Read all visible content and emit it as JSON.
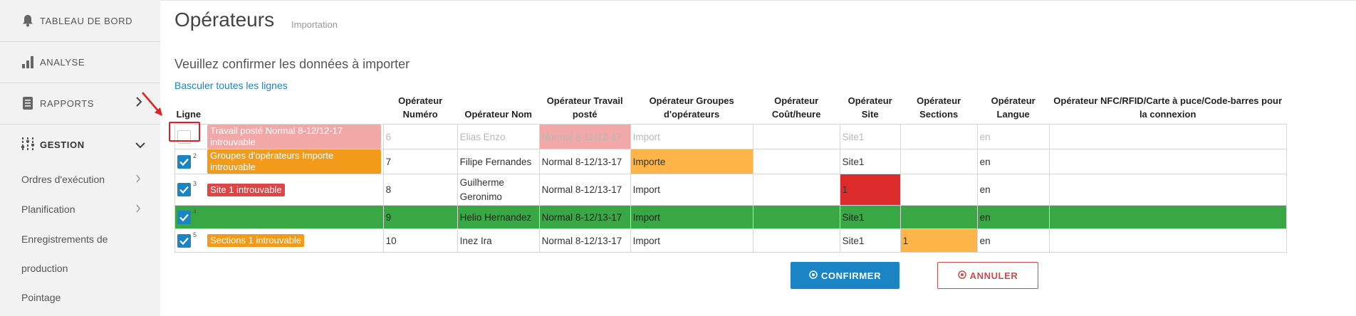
{
  "sidebar": {
    "items": [
      {
        "label": "TABLEAU DE BORD",
        "icon": "bell-icon"
      },
      {
        "label": "ANALYSE",
        "icon": "bar-chart-icon"
      },
      {
        "label": "RAPPORTS",
        "icon": "document-icon"
      },
      {
        "label": "GESTION",
        "icon": "sliders-icon"
      }
    ],
    "sub_items": [
      {
        "label": "Ordres d'exécution"
      },
      {
        "label": "Planification"
      },
      {
        "label": "Enregistrements de"
      },
      {
        "label": "production"
      },
      {
        "label": "Pointage"
      }
    ]
  },
  "page": {
    "title": "Opérateurs",
    "subtitle": "Importation",
    "confirm_text": "Veuillez confirmer les données à importer",
    "toggle_link": "Basculer toutes les lignes"
  },
  "table": {
    "headers": [
      "Ligne",
      "Opérateur Numéro",
      "Opérateur Nom",
      "Opérateur Travail posté",
      "Opérateur Groupes d'opérateurs",
      "Opérateur Coût/heure",
      "Opérateur Site",
      "Opérateur Sections",
      "Opérateur Langue",
      "Opérateur NFC/RFID/Carte à puce/Code-barres pour la connexion"
    ],
    "rows": [
      {
        "num": "",
        "checked": false,
        "error": "Travail posté Normal 8-12/12-17 introuvable",
        "numero": "6",
        "nom": "Elias Enzo",
        "travail": "Normal 8-12/12-17",
        "groupes": "Import",
        "cout": "",
        "site": "Site1",
        "sections": "",
        "langue": "en",
        "nfc": ""
      },
      {
        "num": "2",
        "checked": true,
        "error": "Groupes d'opérateurs Importe introuvable",
        "numero": "7",
        "nom": "Filipe Fernandes",
        "travail": "Normal 8-12/13-17",
        "groupes": "Importe",
        "cout": "",
        "site": "Site1",
        "sections": "",
        "langue": "en",
        "nfc": ""
      },
      {
        "num": "3",
        "checked": true,
        "error": "Site 1 introuvable",
        "numero": "8",
        "nom": "Guilherme Geronimo",
        "travail": "Normal 8-12/13-17",
        "groupes": "Import",
        "cout": "",
        "site": "1",
        "sections": "",
        "langue": "en",
        "nfc": ""
      },
      {
        "num": "4",
        "checked": true,
        "error": "",
        "numero": "9",
        "nom": "Helio Hernandez",
        "travail": "Normal 8-12/13-17",
        "groupes": "Import",
        "cout": "",
        "site": "Site1",
        "sections": "",
        "langue": "en",
        "nfc": ""
      },
      {
        "num": "5",
        "checked": true,
        "error": "Sections 1 introuvable",
        "numero": "10",
        "nom": "Inez Ira",
        "travail": "Normal 8-12/13-17",
        "groupes": "Import",
        "cout": "",
        "site": "Site1",
        "sections": "1",
        "langue": "en",
        "nfc": ""
      }
    ]
  },
  "buttons": {
    "confirm": "CONFIRMER",
    "cancel": "ANNULER"
  },
  "colors": {
    "accent": "#1b84c4",
    "success": "#39a844",
    "warning": "#fdb549",
    "error": "#dd2b2b",
    "error_light": "#f3a8a8"
  }
}
